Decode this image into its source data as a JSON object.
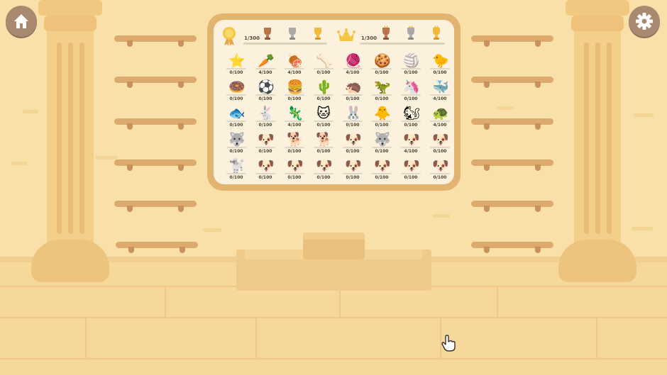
{
  "header": {
    "left": {
      "count": "1/300",
      "medal": "medal-icon",
      "trophies": [
        "trophy-bronze-icon",
        "trophy-silver-icon",
        "trophy-gold-icon"
      ]
    },
    "right": {
      "count": "1/300",
      "crown": "crown-icon",
      "trophies": [
        "trophy-bronze-icon",
        "trophy-silver-icon",
        "trophy-gold-icon"
      ]
    }
  },
  "items": [
    {
      "name": "star",
      "glyph": "⭐",
      "count": "0/100"
    },
    {
      "name": "carrot",
      "glyph": "🥕",
      "count": "4/100"
    },
    {
      "name": "meat",
      "glyph": "🍖",
      "count": "4/100"
    },
    {
      "name": "bone",
      "glyph": "🦴",
      "count": "0/100"
    },
    {
      "name": "yarn-ball",
      "glyph": "🧶",
      "count": "4/100"
    },
    {
      "name": "cookie",
      "glyph": "🍪",
      "count": "0/100"
    },
    {
      "name": "beach-ball",
      "glyph": "🏐",
      "count": "0/100"
    },
    {
      "name": "rubber-duck",
      "glyph": "🐤",
      "count": "0/100"
    },
    {
      "name": "donut",
      "glyph": "🍩",
      "count": "0/100"
    },
    {
      "name": "soccer-ball",
      "glyph": "⚽",
      "count": "0/100"
    },
    {
      "name": "burger",
      "glyph": "🍔",
      "count": "0/100"
    },
    {
      "name": "cactus",
      "glyph": "🌵",
      "count": "0/100"
    },
    {
      "name": "hedgehog",
      "glyph": "🦔",
      "count": "0/100"
    },
    {
      "name": "dino-toy",
      "glyph": "🦖",
      "count": "0/100"
    },
    {
      "name": "unicorn",
      "glyph": "🦄",
      "count": "0/100"
    },
    {
      "name": "whale",
      "glyph": "🐳",
      "count": "4/100"
    },
    {
      "name": "fish",
      "glyph": "🐟",
      "count": "0/100"
    },
    {
      "name": "rabbit",
      "glyph": "🐇",
      "count": "0/100"
    },
    {
      "name": "lizard",
      "glyph": "🦎",
      "count": "4/100"
    },
    {
      "name": "cat",
      "glyph": "🐱",
      "count": "0/100"
    },
    {
      "name": "bunny",
      "glyph": "🐰",
      "count": "0/100"
    },
    {
      "name": "chick",
      "glyph": "🐥",
      "count": "0/100"
    },
    {
      "name": "squirrel",
      "glyph": "🐿",
      "count": "0/100"
    },
    {
      "name": "turtle",
      "glyph": "🐢",
      "count": "4/100"
    },
    {
      "name": "husky",
      "glyph": "🐺",
      "count": "0/100"
    },
    {
      "name": "white-dog",
      "glyph": "🐶",
      "count": "0/100"
    },
    {
      "name": "shiba",
      "glyph": "🐕",
      "count": "0/100"
    },
    {
      "name": "brown-dog",
      "glyph": "🐕",
      "count": "0/100"
    },
    {
      "name": "corgi",
      "glyph": "🐶",
      "count": "0/100"
    },
    {
      "name": "husky-2",
      "glyph": "🐺",
      "count": "0/100"
    },
    {
      "name": "chihuahua",
      "glyph": "🐶",
      "count": "4/100"
    },
    {
      "name": "boston-terrier",
      "glyph": "🐶",
      "count": "0/100"
    },
    {
      "name": "maltese",
      "glyph": "🐩",
      "count": "0/100"
    },
    {
      "name": "spaniel",
      "glyph": "🐶",
      "count": "0/100"
    },
    {
      "name": "schnauzer",
      "glyph": "🐶",
      "count": "0/100"
    },
    {
      "name": "beagle",
      "glyph": "🐶",
      "count": "0/100"
    },
    {
      "name": "pomeranian",
      "glyph": "🐶",
      "count": "0/100"
    },
    {
      "name": "samoyed",
      "glyph": "🐶",
      "count": "0/100"
    },
    {
      "name": "dachshund",
      "glyph": "🐶",
      "count": "0/100"
    },
    {
      "name": "pug",
      "glyph": "🐶",
      "count": "0/100"
    }
  ],
  "buttons": {
    "home": "home-icon",
    "settings": "gear-icon"
  },
  "colors": {
    "wall": "#f9e0a8",
    "frame": "#e3b46f",
    "board": "#fbf1dc",
    "button": "#a98a70"
  }
}
